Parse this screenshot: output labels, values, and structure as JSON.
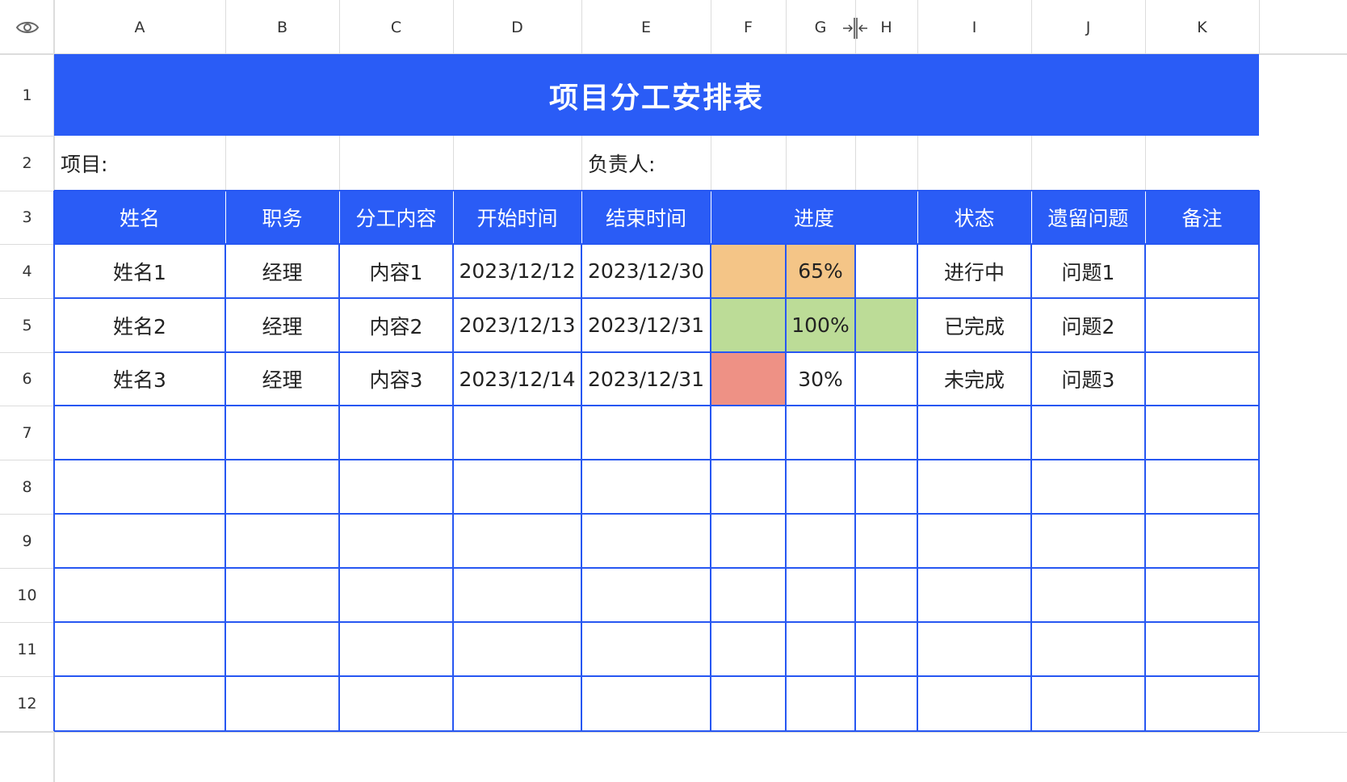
{
  "column_headers": [
    "A",
    "B",
    "C",
    "D",
    "E",
    "F",
    "G",
    "H",
    "I",
    "J",
    "K"
  ],
  "row_headers": [
    "1",
    "2",
    "3",
    "4",
    "5",
    "6",
    "7",
    "8",
    "9",
    "10",
    "11",
    "12"
  ],
  "toolbar": {
    "visibility_icon": "eye-icon",
    "resize_icon": "column-resize-icon"
  },
  "title": "项目分工安排表",
  "meta": {
    "project_label": "项目:",
    "owner_label": "负责人:"
  },
  "table_headers": [
    "姓名",
    "职务",
    "分工内容",
    "开始时间",
    "结束时间",
    "进度",
    "状态",
    "遗留问题",
    "备注"
  ],
  "rows": [
    {
      "name": "姓名1",
      "role": "经理",
      "content": "内容1",
      "start": "2023/12/12",
      "end": "2023/12/30",
      "progress_pct": 65,
      "progress_label": "65%",
      "status": "进行中",
      "issue": "问题1",
      "note": ""
    },
    {
      "name": "姓名2",
      "role": "经理",
      "content": "内容2",
      "start": "2023/12/13",
      "end": "2023/12/31",
      "progress_pct": 100,
      "progress_label": "100%",
      "status": "已完成",
      "issue": "问题2",
      "note": ""
    },
    {
      "name": "姓名3",
      "role": "经理",
      "content": "内容3",
      "start": "2023/12/14",
      "end": "2023/12/31",
      "progress_pct": 30,
      "progress_label": "30%",
      "status": "未完成",
      "issue": "问题3",
      "note": ""
    }
  ],
  "colors": {
    "header_blue": "#2a5cf6",
    "progress_orange": "#f4c587",
    "progress_green": "#bcdc97",
    "progress_red": "#ee9185"
  }
}
